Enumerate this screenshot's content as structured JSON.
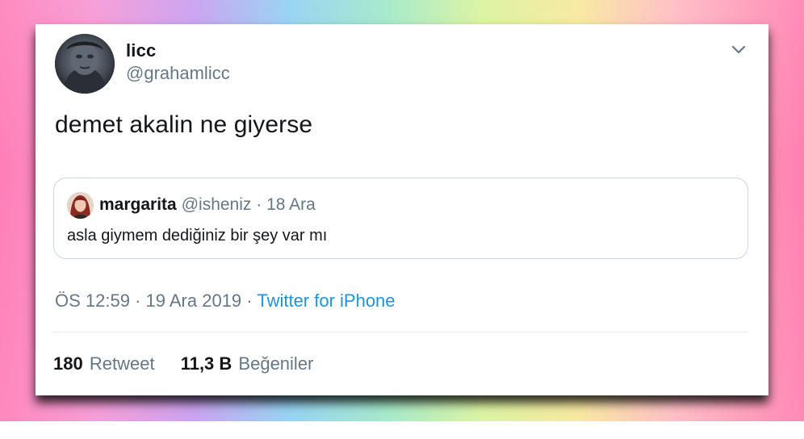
{
  "tweet": {
    "author": {
      "name": "licc",
      "handle": "@grahamlicc",
      "avatar_icon": "user-avatar"
    },
    "more_icon": "chevron-down-icon",
    "text": "demet akalin ne giyerse",
    "quoted": {
      "name": "margarita",
      "meta": "@isheniz · 18 Ara",
      "text": "asla giymem dediğiniz bir şey var mı",
      "avatar_icon": "user-avatar"
    },
    "timestamp": "ÖS 12:59 · 19 Ara 2019",
    "separator": "·",
    "source": "Twitter for iPhone",
    "stats": {
      "retweets_count": "180",
      "retweets_label": "Retweet",
      "likes_count": "11,3 B",
      "likes_label": "Beğeniler"
    }
  },
  "colors": {
    "text_primary": "#14171a",
    "text_secondary": "#657786",
    "link": "#1b95e0",
    "border": "#ccd6dd"
  }
}
